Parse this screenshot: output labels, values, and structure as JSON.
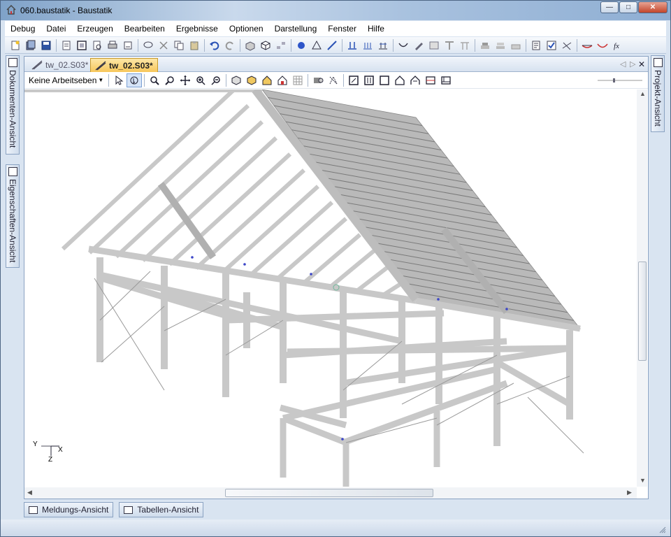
{
  "window": {
    "title": "060.baustatik - Baustatik"
  },
  "menu": [
    "Debug",
    "Datei",
    "Erzeugen",
    "Bearbeiten",
    "Ergebnisse",
    "Optionen",
    "Darstellung",
    "Fenster",
    "Hilfe"
  ],
  "side_tabs": {
    "documents": "Dokumenten-Ansicht",
    "properties": "Eigenschaften-Ansicht",
    "project": "Projekt-Ansicht"
  },
  "doc_tabs": [
    {
      "label": "tw_02.S03*"
    },
    {
      "label": "tw_02.S03*"
    }
  ],
  "view_toolbar": {
    "layer_dropdown": "Keine Arbeitseben"
  },
  "axes": {
    "y": "Y",
    "x": "X",
    "z": "Z"
  },
  "bottom_tabs": [
    {
      "label": "Meldungs-Ansicht"
    },
    {
      "label": "Tabellen-Ansicht"
    }
  ],
  "colors": {
    "accent_tab": "#f7c75b",
    "chrome": "#d9e4f1",
    "beam": "#c8c8c8"
  }
}
